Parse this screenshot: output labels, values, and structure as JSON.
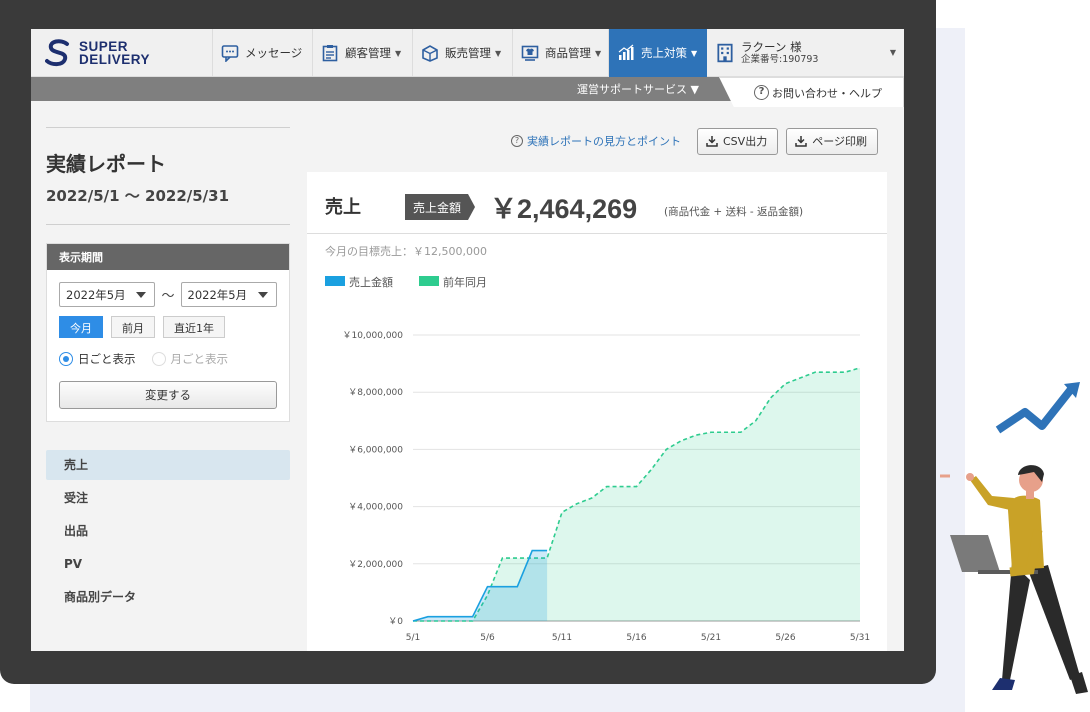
{
  "brand": {
    "line1": "SUPER",
    "line2": "DELIVERY"
  },
  "nav": {
    "message": "メッセージ",
    "customers": "顧客管理",
    "sales_mgmt": "販売管理",
    "products": "商品管理",
    "sales_measures": "売上対策",
    "user_name": "ラクーン 様",
    "company_no": "企業番号:190793"
  },
  "subbar": {
    "support": "運営サポートサービス ▼",
    "help": "お問い合わせ・ヘルプ"
  },
  "report": {
    "title": "実績レポート",
    "range": "2022/5/1 〜 2022/5/31"
  },
  "period": {
    "heading": "表示期間",
    "from": "2022年5月",
    "to": "2022年5月",
    "tilde": "〜",
    "btn_this_month": "今月",
    "btn_last_month": "前月",
    "btn_last_year": "直近1年",
    "radio_daily": "日ごと表示",
    "radio_monthly": "月ごと表示",
    "change_button": "変更する"
  },
  "menu": [
    {
      "label": "売上"
    },
    {
      "label": "受注"
    },
    {
      "label": "出品"
    },
    {
      "label": "PV"
    },
    {
      "label": "商品別データ"
    }
  ],
  "tools": {
    "guide": "実績レポートの見方とポイント",
    "csv": "CSV出力",
    "print": "ページ印刷"
  },
  "summary": {
    "label": "売上",
    "badge": "売上金額",
    "amount": "￥2,464,269",
    "note": "(商品代金 + 送料 - 返品金額)",
    "target": "今月の目標売上：￥12,500,000"
  },
  "colors": {
    "current": "#1aa0e0",
    "previous": "#2ecc8f",
    "accent": "#2e73b8"
  },
  "chart_data": {
    "type": "area",
    "title": "",
    "xlabel": "",
    "ylabel": "",
    "ylim": [
      0,
      10000000
    ],
    "yticks": [
      "￥0",
      "￥2,000,000",
      "￥4,000,000",
      "￥6,000,000",
      "￥8,000,000",
      "￥10,000,000"
    ],
    "xticks": [
      "5/1",
      "5/6",
      "5/11",
      "5/16",
      "5/21",
      "5/26",
      "5/31"
    ],
    "grid": true,
    "legend": "top-left",
    "series": [
      {
        "name": "売上金額",
        "style": "solid",
        "x": [
          1,
          2,
          3,
          4,
          5,
          6,
          7,
          8,
          9,
          10
        ],
        "values": [
          0,
          150000,
          150000,
          150000,
          150000,
          1200000,
          1200000,
          1200000,
          2464269,
          2464269
        ]
      },
      {
        "name": "前年同月",
        "style": "dashed",
        "x": [
          1,
          2,
          3,
          4,
          5,
          6,
          7,
          8,
          9,
          10,
          11,
          12,
          13,
          14,
          15,
          16,
          17,
          18,
          19,
          20,
          21,
          22,
          23,
          24,
          25,
          26,
          27,
          28,
          29,
          30,
          31
        ],
        "values": [
          0,
          0,
          0,
          0,
          0,
          900000,
          2200000,
          2200000,
          2200000,
          2200000,
          3800000,
          4100000,
          4300000,
          4700000,
          4700000,
          4700000,
          5300000,
          6000000,
          6300000,
          6500000,
          6600000,
          6600000,
          6600000,
          7000000,
          7800000,
          8300000,
          8500000,
          8700000,
          8700000,
          8700000,
          8850000
        ]
      }
    ]
  }
}
